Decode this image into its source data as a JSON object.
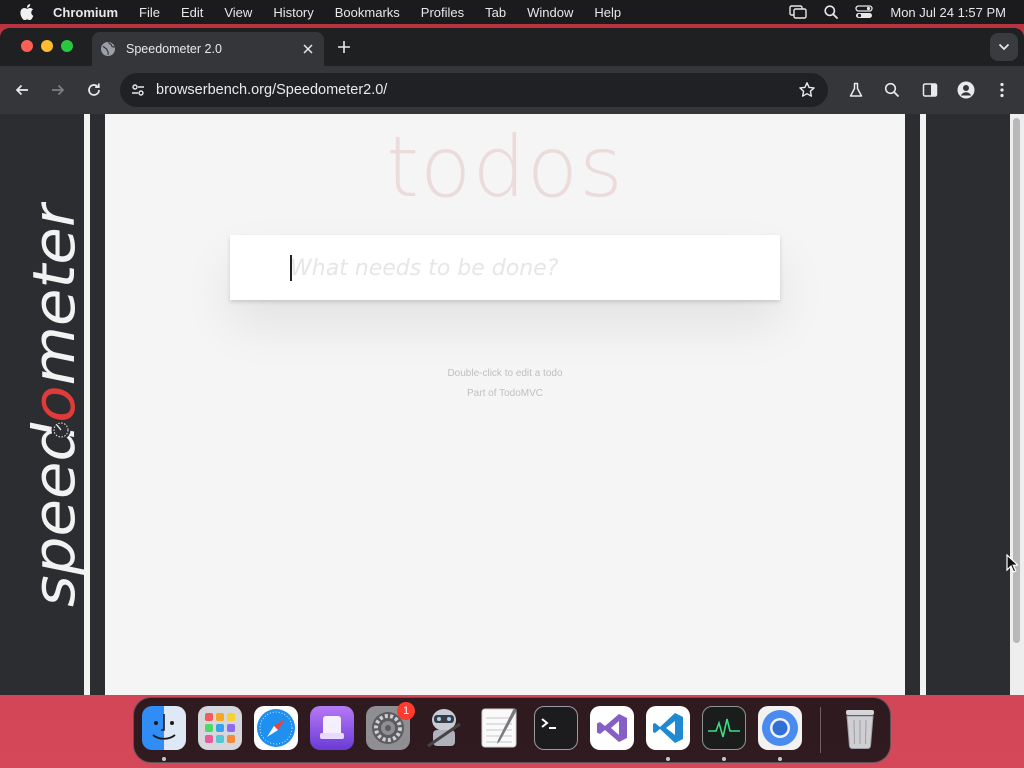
{
  "menubar": {
    "items": [
      "Chromium",
      "File",
      "Edit",
      "View",
      "History",
      "Bookmarks",
      "Profiles",
      "Tab",
      "Window",
      "Help"
    ],
    "clock": "Mon Jul 24  1:57 PM"
  },
  "browser": {
    "tab_title": "Speedometer 2.0",
    "url": "browserbench.org/Speedometer2.0/"
  },
  "page": {
    "logo_text": "speedometer",
    "todo_heading": "todos",
    "todo_placeholder": "What needs to be done?",
    "info_line1": "Double-click to edit a todo",
    "info_part_prefix": "Part of ",
    "info_part_link": "TodoMVC"
  },
  "dock": {
    "apps": [
      "finder",
      "launchpad",
      "safari",
      "simulator",
      "system-settings",
      "automator",
      "textedit",
      "terminal",
      "visual-studio",
      "vscode",
      "activity-monitor",
      "chromium",
      "trash"
    ],
    "system_settings_badge": "1"
  },
  "colors": {
    "logo_red": "#e03b3b",
    "logo_white": "#f2f2f2",
    "todo_title": "#af2f2f"
  }
}
